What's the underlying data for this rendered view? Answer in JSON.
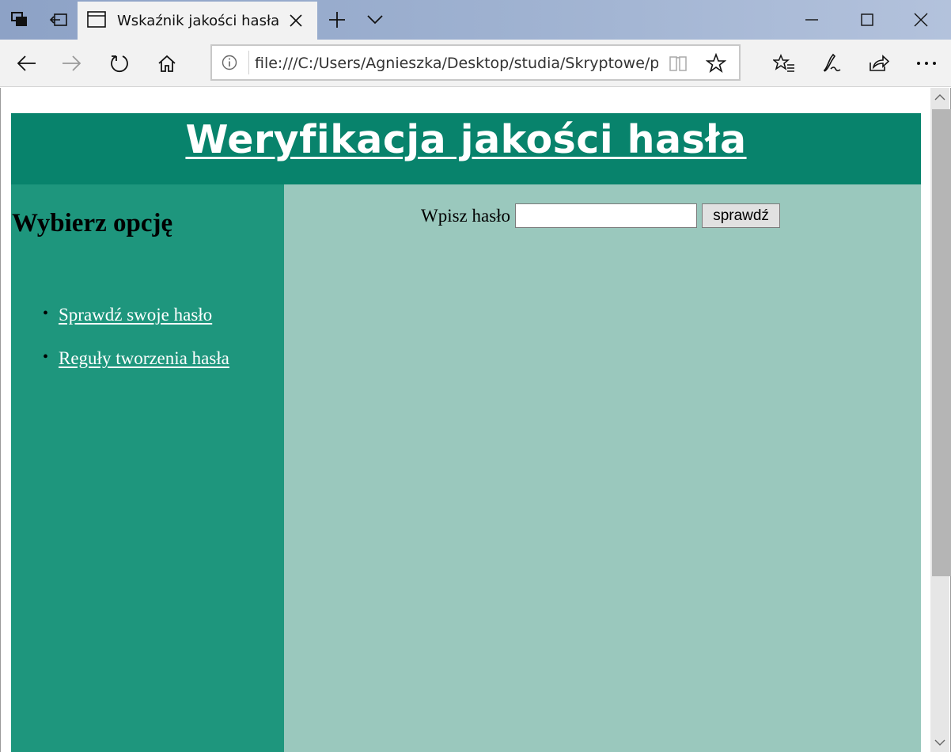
{
  "browser": {
    "tab_title": "Wskaźnik jakości hasła",
    "address": "file:///C:/Users/Agnieszka/Desktop/studia/Skryptowe/projekt/index.html",
    "accent_color": "#9fb2d1"
  },
  "page": {
    "title": "Weryfikacja jakości hasła",
    "sidebar": {
      "heading": "Wybierz opcję",
      "links": [
        {
          "label": "Sprawdź swoje hasło"
        },
        {
          "label": "Reguły tworzenia hasła"
        }
      ]
    },
    "form": {
      "label": "Wpisz hasło",
      "input_value": "",
      "button_label": "sprawdź"
    },
    "colors": {
      "header": "#08836c",
      "sidebar": "#1e967d",
      "content": "#9ac8bd"
    }
  }
}
